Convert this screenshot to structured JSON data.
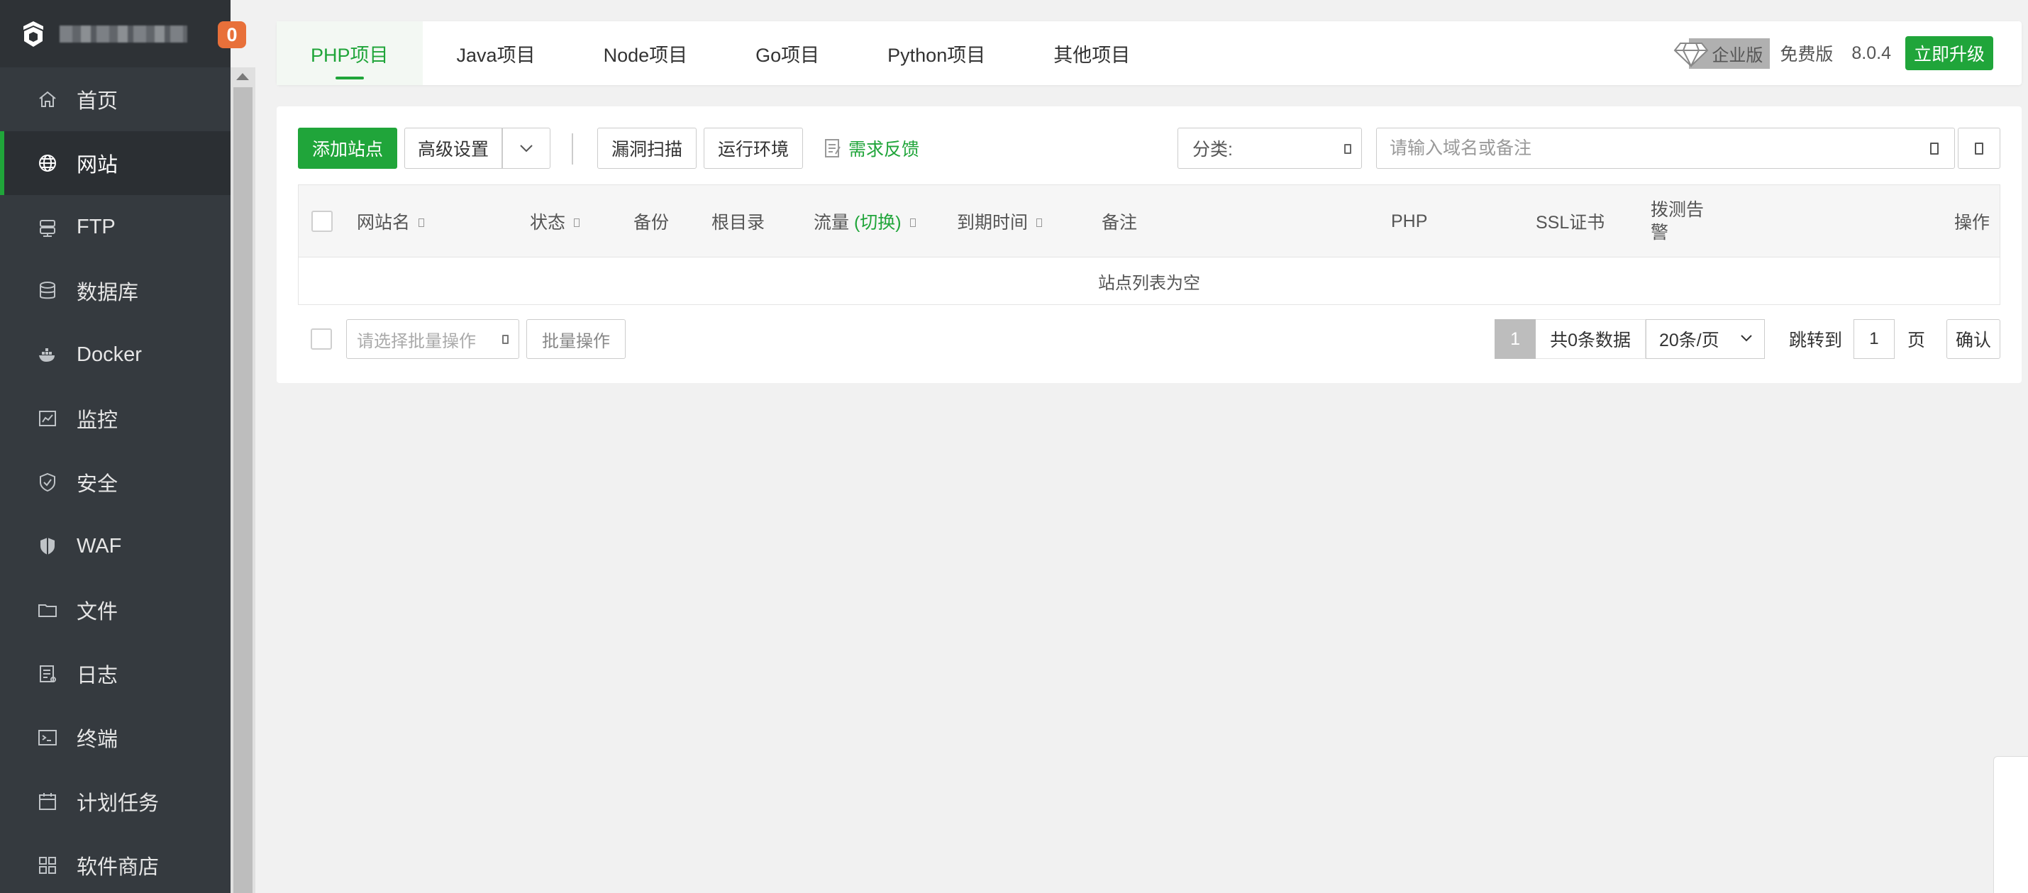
{
  "sidebar": {
    "notification_count": "0",
    "items": [
      {
        "label": "首页",
        "icon": "home-icon"
      },
      {
        "label": "网站",
        "icon": "globe-icon",
        "active": true
      },
      {
        "label": "FTP",
        "icon": "ftp-icon"
      },
      {
        "label": "数据库",
        "icon": "database-icon"
      },
      {
        "label": "Docker",
        "icon": "docker-icon"
      },
      {
        "label": "监控",
        "icon": "monitor-icon"
      },
      {
        "label": "安全",
        "icon": "shield-icon"
      },
      {
        "label": "WAF",
        "icon": "waf-shield-icon"
      },
      {
        "label": "文件",
        "icon": "folder-icon"
      },
      {
        "label": "日志",
        "icon": "log-icon"
      },
      {
        "label": "终端",
        "icon": "terminal-icon"
      },
      {
        "label": "计划任务",
        "icon": "calendar-icon"
      },
      {
        "label": "软件商店",
        "icon": "apps-icon"
      }
    ]
  },
  "tabs": [
    {
      "label": "PHP项目",
      "active": true
    },
    {
      "label": "Java项目"
    },
    {
      "label": "Node项目"
    },
    {
      "label": "Go项目"
    },
    {
      "label": "Python项目"
    },
    {
      "label": "其他项目"
    }
  ],
  "header": {
    "enterprise_label": "企业版",
    "free_label": "免费版",
    "version": "8.0.4",
    "upgrade_label": "立即升级"
  },
  "toolbar": {
    "add_site_label": "添加站点",
    "advanced_label": "高级设置",
    "scan_label": "漏洞扫描",
    "env_label": "运行环境",
    "feedback_label": "需求反馈",
    "category_label": "分类:",
    "search_placeholder": "请输入域名或备注"
  },
  "table": {
    "columns": {
      "name": "网站名",
      "status": "状态",
      "backup": "备份",
      "root": "根目录",
      "traffic": "流量",
      "traffic_switch": "(切换)",
      "expire": "到期时间",
      "remark": "备注",
      "php": "PHP",
      "ssl": "SSL证书",
      "alarm_line1": "拨测告",
      "alarm_line2": "警",
      "ops": "操作"
    },
    "empty_text": "站点列表为空"
  },
  "footer": {
    "batch_placeholder": "请选择批量操作",
    "batch_button": "批量操作",
    "current_page": "1",
    "total_text": "共0条数据",
    "per_page": "20条/页",
    "jump_label": "跳转到",
    "jump_value": "1",
    "page_unit": "页",
    "confirm_label": "确认"
  },
  "colors": {
    "accent": "#20a53a",
    "sidebar_bg": "#353a3f",
    "badge": "#e8703a"
  }
}
